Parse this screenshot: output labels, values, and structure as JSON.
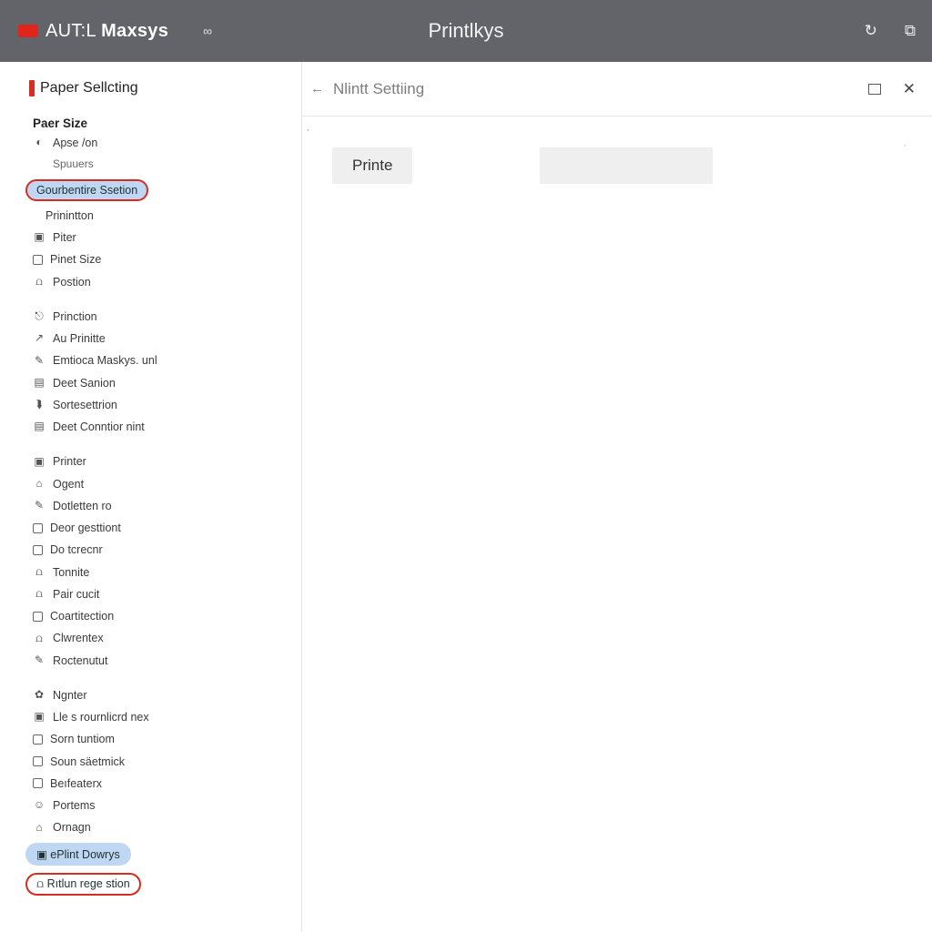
{
  "titlebar": {
    "brand_pre": "AUT:L ",
    "brand_bold": "Maxsys",
    "center": "Printlkys"
  },
  "sidebar": {
    "header": "Paper Sellcting",
    "group1_label": "Paer Size",
    "g1_items": [
      {
        "glyph": "◐",
        "label": "Apse /on"
      },
      {
        "glyph": "",
        "label": "Spuuers"
      }
    ],
    "pill_selected": "Gourbentire Ssetion",
    "g1b_items": [
      {
        "glyph": "",
        "label": "Prinintton",
        "sub": true
      },
      {
        "glyph": "▣",
        "label": "Piter"
      },
      {
        "glyph": "☐",
        "label": "Pinet Size"
      },
      {
        "glyph": "⩍",
        "label": "Postion"
      }
    ],
    "g2_items": [
      {
        "glyph": "⎋",
        "label": "Prinction"
      },
      {
        "glyph": "↗",
        "label": "Au Prinitte"
      },
      {
        "glyph": "✎",
        "label": "Emtioca Maskys. unl"
      },
      {
        "glyph": "▤",
        "label": "Deet Sanion"
      },
      {
        "glyph": "⮯",
        "label": "Sortesettrion"
      },
      {
        "glyph": "▤",
        "label": "Deet Conntior nint"
      }
    ],
    "g3_items": [
      {
        "glyph": "▣",
        "label": "Printer"
      },
      {
        "glyph": "⌂",
        "label": "Ogent"
      },
      {
        "glyph": "✎",
        "label": "Dotletten ro"
      },
      {
        "glyph": "☐",
        "label": "Deor gesttiont"
      },
      {
        "glyph": "☐",
        "label": "Do tcrecnr"
      },
      {
        "glyph": "⩍",
        "label": "Tonnite"
      },
      {
        "glyph": "⩍",
        "label": "Pair cucit"
      },
      {
        "glyph": "☐",
        "label": "Coartitection"
      },
      {
        "glyph": "⩍",
        "label": "Clwrentex"
      },
      {
        "glyph": "✎",
        "label": "Roctenutut"
      }
    ],
    "g4_items": [
      {
        "glyph": "✿",
        "label": "Ngnter"
      },
      {
        "glyph": "▣",
        "label": "Lle s rournlicrd nex"
      },
      {
        "glyph": "☐",
        "label": "Sorn tuntiom"
      },
      {
        "glyph": "☐",
        "label": "Soun säetmick"
      },
      {
        "glyph": "☐",
        "label": "Beıfeaterx"
      },
      {
        "glyph": "☺",
        "label": "Portems"
      },
      {
        "glyph": "⌂",
        "label": "Ornagn"
      }
    ],
    "pill_bottom1": "ePlint Dowrys",
    "pill_bottom2": "Rıtlun rege stion",
    "pill_bottom1_glyph": "▣",
    "pill_bottom2_glyph": "⩍"
  },
  "content": {
    "header": "Nlintt Settiing",
    "printe_label": "Printe"
  }
}
